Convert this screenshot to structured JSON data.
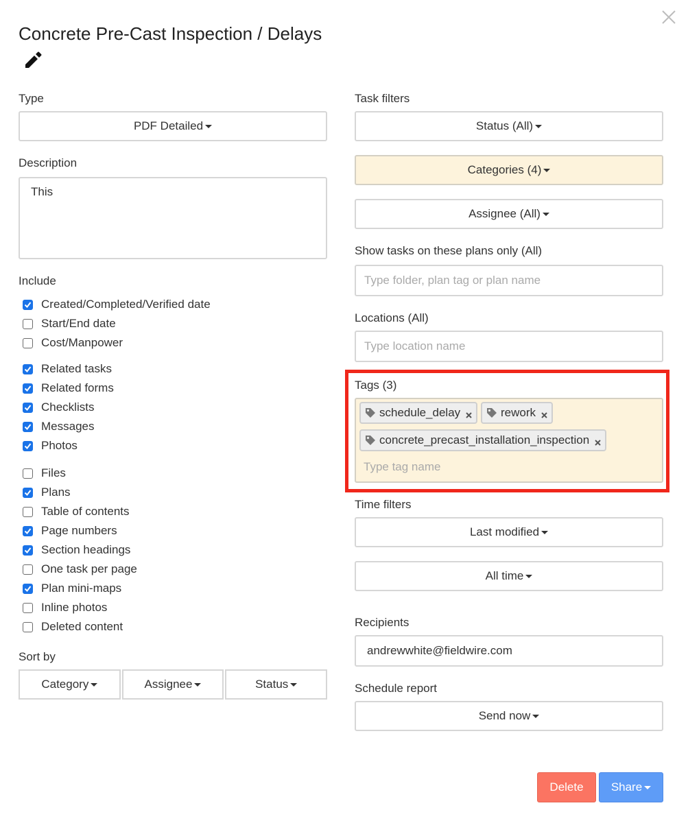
{
  "title": "Concrete Pre-Cast Inspection / Delays",
  "icons": {
    "edit": "pencil-icon",
    "close": "close-icon",
    "tag": "tag-icon",
    "remove": "x-icon"
  },
  "left": {
    "type_label": "Type",
    "type_value": "PDF Detailed",
    "description_label": "Description",
    "description_value": "This",
    "include_label": "Include",
    "include_items": [
      {
        "label": "Created/Completed/Verified date",
        "checked": true
      },
      {
        "label": "Start/End date",
        "checked": false
      },
      {
        "label": "Cost/Manpower",
        "checked": false
      },
      {
        "label": "Related tasks",
        "checked": true
      },
      {
        "label": "Related forms",
        "checked": true
      },
      {
        "label": "Checklists",
        "checked": true
      },
      {
        "label": "Messages",
        "checked": true
      },
      {
        "label": "Photos",
        "checked": true
      },
      {
        "label": "Files",
        "checked": false
      },
      {
        "label": "Plans",
        "checked": true
      },
      {
        "label": "Table of contents",
        "checked": false
      },
      {
        "label": "Page numbers",
        "checked": true
      },
      {
        "label": "Section headings",
        "checked": true
      },
      {
        "label": "One task per page",
        "checked": false
      },
      {
        "label": "Plan mini-maps",
        "checked": true
      },
      {
        "label": "Inline photos",
        "checked": false
      },
      {
        "label": "Deleted content",
        "checked": false
      }
    ],
    "sort_label": "Sort by",
    "sort_options": [
      "Category",
      "Assignee",
      "Status"
    ]
  },
  "right": {
    "task_filters_label": "Task filters",
    "status_value": "Status (All)",
    "categories_value": "Categories (4)",
    "assignee_value": "Assignee (All)",
    "plans_label": "Show tasks on these plans only (All)",
    "plans_placeholder": "Type folder, plan tag or plan name",
    "locations_label": "Locations (All)",
    "locations_placeholder": "Type location name",
    "tags_label": "Tags (3)",
    "tags": [
      "schedule_delay",
      "rework",
      "concrete_precast_installation_inspection"
    ],
    "tags_placeholder": "Type tag name",
    "time_filters_label": "Time filters",
    "last_modified_value": "Last modified",
    "all_time_value": "All time",
    "recipients_label": "Recipients",
    "recipients_value": "andrewwhite@fieldwire.com",
    "schedule_label": "Schedule report",
    "schedule_value": "Send now"
  },
  "actions": {
    "delete_label": "Delete",
    "share_label": "Share"
  },
  "colors": {
    "accent": "#1a73e8",
    "highlight_bg": "#fdf3dc",
    "delete": "#fb7462",
    "share": "#5e9cf7",
    "annotation": "#f0271b"
  }
}
